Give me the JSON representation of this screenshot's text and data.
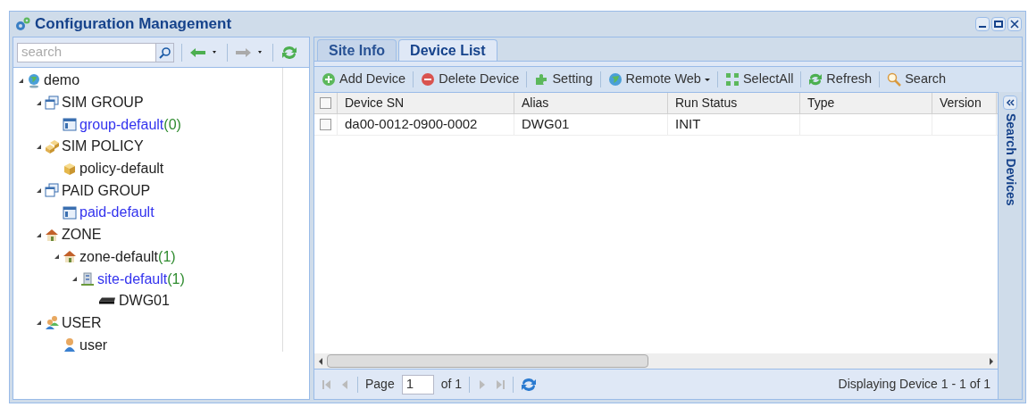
{
  "window": {
    "title": "Configuration Management"
  },
  "sidebar": {
    "search": {
      "placeholder": "search"
    },
    "tree": [
      {
        "label": "demo",
        "kind": "globe",
        "link": false,
        "expanded": true,
        "children": [
          {
            "label": "SIM GROUP",
            "kind": "windows",
            "link": false,
            "expanded": true,
            "children": [
              {
                "label": "group-default",
                "count": "(0)",
                "kind": "window",
                "link": true
              }
            ]
          },
          {
            "label": "SIM POLICY",
            "kind": "boxes",
            "link": false,
            "expanded": true,
            "children": [
              {
                "label": "policy-default",
                "kind": "box",
                "link": false
              }
            ]
          },
          {
            "label": "PAID GROUP",
            "kind": "windows",
            "link": false,
            "expanded": true,
            "children": [
              {
                "label": "paid-default",
                "kind": "window",
                "link": true
              }
            ]
          },
          {
            "label": "ZONE",
            "kind": "house",
            "link": false,
            "expanded": true,
            "children": [
              {
                "label": "zone-default",
                "count": "(1)",
                "kind": "house",
                "link": false,
                "expanded": true,
                "children": [
                  {
                    "label": "site-default",
                    "count": "(1)",
                    "kind": "building",
                    "link": true,
                    "expanded": true,
                    "children": [
                      {
                        "label": "DWG01",
                        "kind": "device",
                        "link": false
                      }
                    ]
                  }
                ]
              }
            ]
          },
          {
            "label": "USER",
            "kind": "users",
            "link": false,
            "expanded": true,
            "children": [
              {
                "label": "user",
                "kind": "user",
                "link": false
              }
            ]
          }
        ]
      }
    ]
  },
  "tabs": [
    {
      "label": "Site Info",
      "selected": false
    },
    {
      "label": "Device List",
      "selected": true
    }
  ],
  "toolbar": [
    {
      "label": "Add Device",
      "kind": "add"
    },
    {
      "label": "Delete Device",
      "kind": "delete"
    },
    {
      "label": "Setting",
      "kind": "puzzle"
    },
    {
      "label": "Remote Web",
      "kind": "globe",
      "menu": true
    },
    {
      "label": "SelectAll",
      "kind": "grid"
    },
    {
      "label": "Refresh",
      "kind": "refresh"
    },
    {
      "label": "Search",
      "kind": "search"
    }
  ],
  "table": {
    "all_checked": false,
    "columns": [
      "Device SN",
      "Alias",
      "Run Status",
      "Type",
      "Version"
    ],
    "rows": [
      {
        "checked": false,
        "cells": [
          "da00-0012-0900-0002",
          "DWG01",
          "INIT",
          "",
          ""
        ]
      }
    ]
  },
  "search_panel": {
    "title": "Search Devices"
  },
  "pager": {
    "page_label": "Page",
    "page": "1",
    "of": "of 1",
    "status": "Displaying Device 1 - 1 of 1"
  }
}
